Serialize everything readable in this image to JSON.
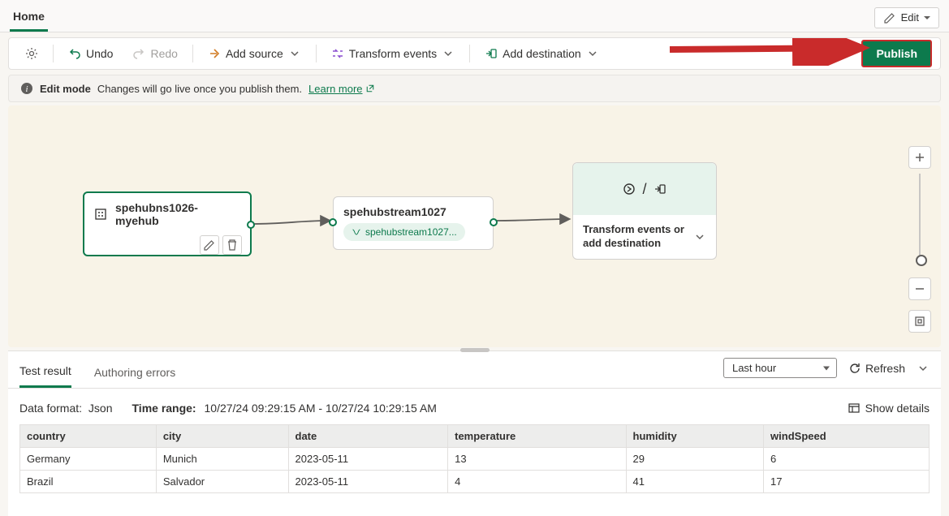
{
  "tabs": {
    "home": "Home"
  },
  "editBtn": "Edit",
  "toolbar": {
    "undo": "Undo",
    "redo": "Redo",
    "addSource": "Add source",
    "transform": "Transform events",
    "addDest": "Add destination",
    "publish": "Publish"
  },
  "banner": {
    "mode": "Edit mode",
    "msg": "Changes will go live once you publish them.",
    "learn": "Learn more"
  },
  "nodes": {
    "source": {
      "title": "spehubns1026-myehub"
    },
    "stream": {
      "title": "spehubstream1027",
      "pill": "spehubstream1027..."
    },
    "dest": {
      "title": "Transform events or add destination"
    }
  },
  "bottom": {
    "tabs": {
      "test": "Test result",
      "errors": "Authoring errors"
    },
    "timeSelect": "Last hour",
    "refresh": "Refresh",
    "dataFormatLabel": "Data format:",
    "dataFormatValue": "Json",
    "timeRangeLabel": "Time range:",
    "timeRangeValue": "10/27/24 09:29:15 AM - 10/27/24 10:29:15 AM",
    "showDetails": "Show details",
    "columns": [
      "country",
      "city",
      "date",
      "temperature",
      "humidity",
      "windSpeed"
    ],
    "rows": [
      {
        "country": "Germany",
        "city": "Munich",
        "date": "2023-05-11",
        "temperature": "13",
        "humidity": "29",
        "windSpeed": "6"
      },
      {
        "country": "Brazil",
        "city": "Salvador",
        "date": "2023-05-11",
        "temperature": "4",
        "humidity": "41",
        "windSpeed": "17"
      }
    ]
  }
}
